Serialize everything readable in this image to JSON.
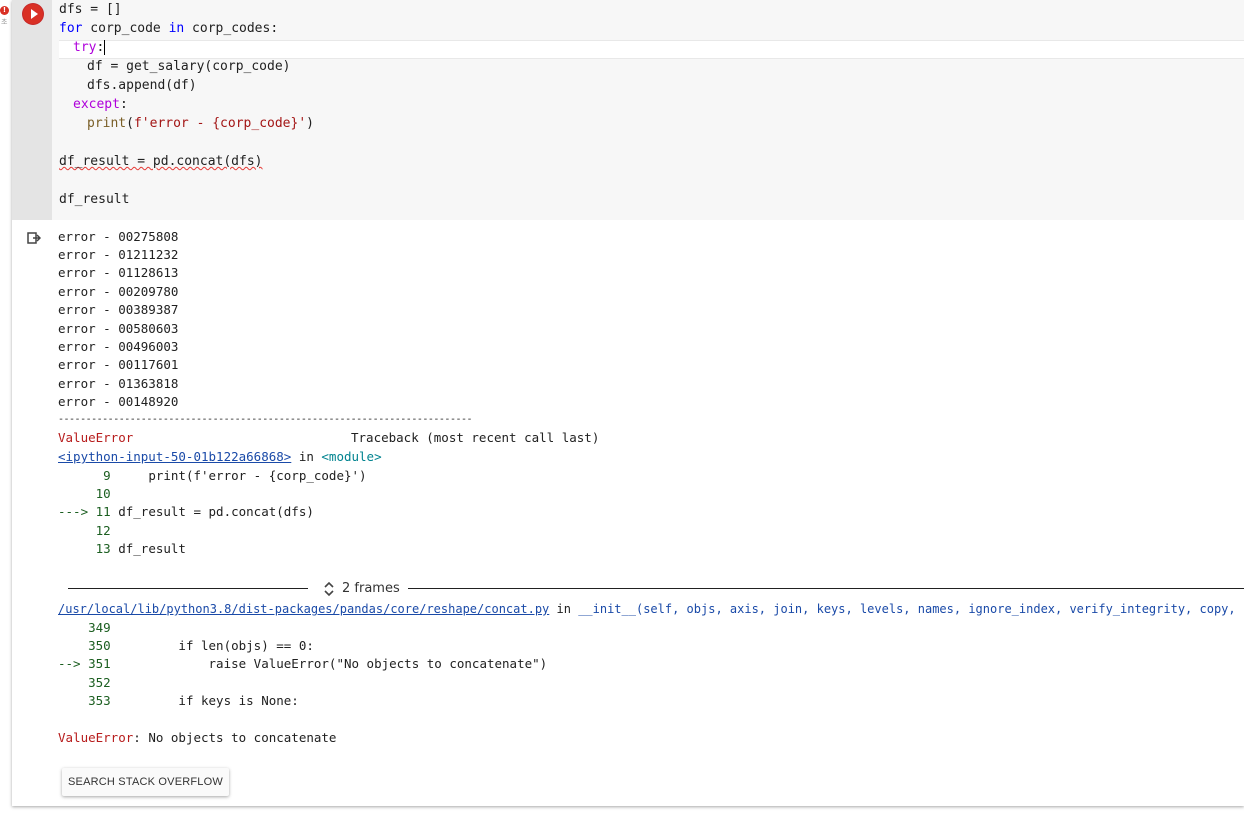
{
  "gutter": {
    "badge": "!",
    "badge_sub": "초"
  },
  "code": {
    "l1": "dfs = []",
    "l2_for": "for",
    "l2_mid": " corp_code ",
    "l2_in": "in",
    "l2_rest": " corp_codes:",
    "l3_try": "try",
    "l3_colon": ":",
    "l4": "df = get_salary(corp_code)",
    "l5": "dfs.append(df)",
    "l6_except": "except",
    "l6_colon": ":",
    "l7_print": "print",
    "l7_open": "(",
    "l7_str": "f'error - {corp_code}'",
    "l7_close": ")",
    "l9": "df_result = pd.concat(dfs)",
    "l11": "df_result"
  },
  "output": {
    "errors": [
      "error - 00275808",
      "error - 01211232",
      "error - 01128613",
      "error - 00209780",
      "error - 00389387",
      "error - 00580603",
      "error - 00496003",
      "error - 00117601",
      "error - 01363818",
      "error - 00148920"
    ],
    "separator": "---------------------------------------------------------------------------",
    "exc_name": "ValueError",
    "traceback_label": "Traceback (most recent call last)",
    "input_link": "<ipython-input-50-01b122a66868>",
    "in_word": " in ",
    "module": "<module>",
    "tb1": [
      {
        "num": "      9",
        "code": "     print(f'error - {corp_code}')"
      },
      {
        "num": "     10",
        "code": ""
      },
      {
        "num": "---> 11",
        "code": " df_result = pd.concat(dfs)"
      },
      {
        "num": "     12",
        "code": ""
      },
      {
        "num": "     13",
        "code": " df_result"
      }
    ],
    "frames_label": "2 frames",
    "file_link": "/usr/local/lib/python3.8/dist-packages/pandas/core/reshape/concat.py",
    "file_in": " in ",
    "file_func": "__init__(self, objs, axis, join, keys, levels, names, ignore_index, verify_integrity, copy, sort)",
    "tb2": [
      {
        "num": "    349",
        "code": ""
      },
      {
        "num": "    350",
        "code": "         if len(objs) == 0:"
      },
      {
        "num": "--> 351",
        "code": "             raise ValueError(\"No objects to concatenate\")"
      },
      {
        "num": "    352",
        "code": ""
      },
      {
        "num": "    353",
        "code": "         if keys is None:"
      }
    ],
    "final_exc": "ValueError",
    "final_msg": ": No objects to concatenate",
    "so_button": "SEARCH STACK OVERFLOW"
  }
}
